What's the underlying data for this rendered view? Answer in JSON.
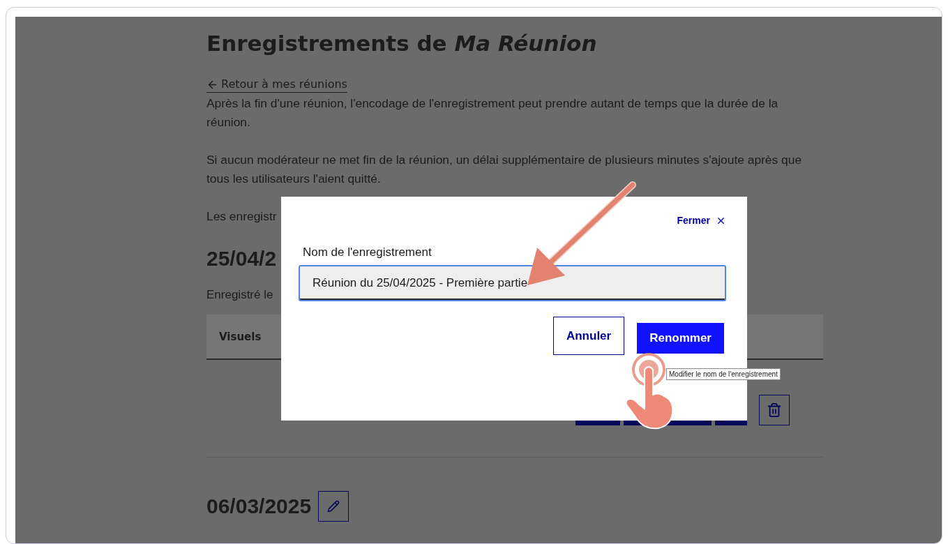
{
  "page": {
    "title": "Enregistrements de *Ma Réunion*",
    "back_link": "Retour à mes réunions",
    "paragraphs": [
      "Après la fin d'une réunion, l'encodage de l'enregistrement peut prendre autant de temps que la durée de la réunion.",
      "Si aucun modérateur ne met fin de la réunion, un délai supplémentaire de plusieurs minutes s'ajoute après que tous les utilisateurs l'aient quitté.",
      "Les enregistr"
    ],
    "recordings": [
      {
        "date": "25/04/2",
        "recorded_on": "Enregistré le",
        "columns": [
          "Visuels"
        ]
      },
      {
        "date": "06/03/2025"
      }
    ]
  },
  "dialog": {
    "close": "Fermer",
    "field": {
      "label": "Nom de l'enregistrement",
      "value": "Réunion du 25/04/2025 - Première partie"
    },
    "buttons": [
      {
        "label": "Annuler",
        "kind": "secondary"
      },
      {
        "label": "Renommer",
        "kind": "primary"
      }
    ]
  },
  "tooltip": "Modifier le nom de l'enregistrement"
}
